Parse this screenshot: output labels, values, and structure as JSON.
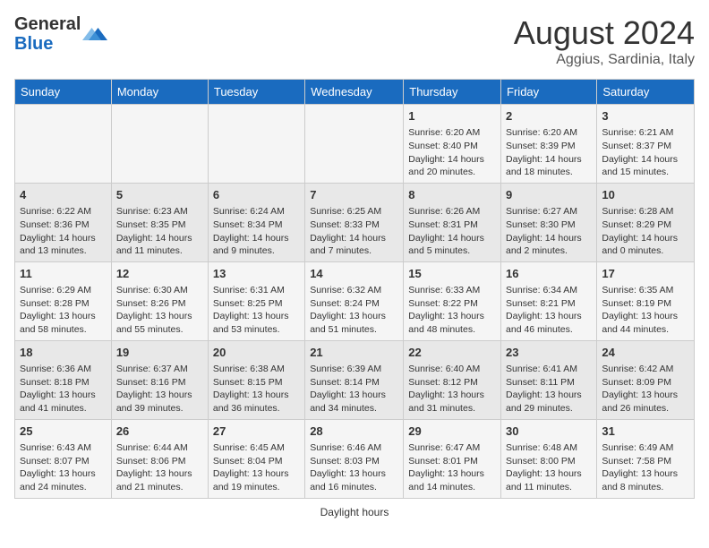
{
  "header": {
    "logo_general": "General",
    "logo_blue": "Blue",
    "month_year": "August 2024",
    "location": "Aggius, Sardinia, Italy"
  },
  "days_of_week": [
    "Sunday",
    "Monday",
    "Tuesday",
    "Wednesday",
    "Thursday",
    "Friday",
    "Saturday"
  ],
  "weeks": [
    [
      {
        "day": "",
        "content": ""
      },
      {
        "day": "",
        "content": ""
      },
      {
        "day": "",
        "content": ""
      },
      {
        "day": "",
        "content": ""
      },
      {
        "day": "1",
        "content": "Sunrise: 6:20 AM\nSunset: 8:40 PM\nDaylight: 14 hours and 20 minutes."
      },
      {
        "day": "2",
        "content": "Sunrise: 6:20 AM\nSunset: 8:39 PM\nDaylight: 14 hours and 18 minutes."
      },
      {
        "day": "3",
        "content": "Sunrise: 6:21 AM\nSunset: 8:37 PM\nDaylight: 14 hours and 15 minutes."
      }
    ],
    [
      {
        "day": "4",
        "content": "Sunrise: 6:22 AM\nSunset: 8:36 PM\nDaylight: 14 hours and 13 minutes."
      },
      {
        "day": "5",
        "content": "Sunrise: 6:23 AM\nSunset: 8:35 PM\nDaylight: 14 hours and 11 minutes."
      },
      {
        "day": "6",
        "content": "Sunrise: 6:24 AM\nSunset: 8:34 PM\nDaylight: 14 hours and 9 minutes."
      },
      {
        "day": "7",
        "content": "Sunrise: 6:25 AM\nSunset: 8:33 PM\nDaylight: 14 hours and 7 minutes."
      },
      {
        "day": "8",
        "content": "Sunrise: 6:26 AM\nSunset: 8:31 PM\nDaylight: 14 hours and 5 minutes."
      },
      {
        "day": "9",
        "content": "Sunrise: 6:27 AM\nSunset: 8:30 PM\nDaylight: 14 hours and 2 minutes."
      },
      {
        "day": "10",
        "content": "Sunrise: 6:28 AM\nSunset: 8:29 PM\nDaylight: 14 hours and 0 minutes."
      }
    ],
    [
      {
        "day": "11",
        "content": "Sunrise: 6:29 AM\nSunset: 8:28 PM\nDaylight: 13 hours and 58 minutes."
      },
      {
        "day": "12",
        "content": "Sunrise: 6:30 AM\nSunset: 8:26 PM\nDaylight: 13 hours and 55 minutes."
      },
      {
        "day": "13",
        "content": "Sunrise: 6:31 AM\nSunset: 8:25 PM\nDaylight: 13 hours and 53 minutes."
      },
      {
        "day": "14",
        "content": "Sunrise: 6:32 AM\nSunset: 8:24 PM\nDaylight: 13 hours and 51 minutes."
      },
      {
        "day": "15",
        "content": "Sunrise: 6:33 AM\nSunset: 8:22 PM\nDaylight: 13 hours and 48 minutes."
      },
      {
        "day": "16",
        "content": "Sunrise: 6:34 AM\nSunset: 8:21 PM\nDaylight: 13 hours and 46 minutes."
      },
      {
        "day": "17",
        "content": "Sunrise: 6:35 AM\nSunset: 8:19 PM\nDaylight: 13 hours and 44 minutes."
      }
    ],
    [
      {
        "day": "18",
        "content": "Sunrise: 6:36 AM\nSunset: 8:18 PM\nDaylight: 13 hours and 41 minutes."
      },
      {
        "day": "19",
        "content": "Sunrise: 6:37 AM\nSunset: 8:16 PM\nDaylight: 13 hours and 39 minutes."
      },
      {
        "day": "20",
        "content": "Sunrise: 6:38 AM\nSunset: 8:15 PM\nDaylight: 13 hours and 36 minutes."
      },
      {
        "day": "21",
        "content": "Sunrise: 6:39 AM\nSunset: 8:14 PM\nDaylight: 13 hours and 34 minutes."
      },
      {
        "day": "22",
        "content": "Sunrise: 6:40 AM\nSunset: 8:12 PM\nDaylight: 13 hours and 31 minutes."
      },
      {
        "day": "23",
        "content": "Sunrise: 6:41 AM\nSunset: 8:11 PM\nDaylight: 13 hours and 29 minutes."
      },
      {
        "day": "24",
        "content": "Sunrise: 6:42 AM\nSunset: 8:09 PM\nDaylight: 13 hours and 26 minutes."
      }
    ],
    [
      {
        "day": "25",
        "content": "Sunrise: 6:43 AM\nSunset: 8:07 PM\nDaylight: 13 hours and 24 minutes."
      },
      {
        "day": "26",
        "content": "Sunrise: 6:44 AM\nSunset: 8:06 PM\nDaylight: 13 hours and 21 minutes."
      },
      {
        "day": "27",
        "content": "Sunrise: 6:45 AM\nSunset: 8:04 PM\nDaylight: 13 hours and 19 minutes."
      },
      {
        "day": "28",
        "content": "Sunrise: 6:46 AM\nSunset: 8:03 PM\nDaylight: 13 hours and 16 minutes."
      },
      {
        "day": "29",
        "content": "Sunrise: 6:47 AM\nSunset: 8:01 PM\nDaylight: 13 hours and 14 minutes."
      },
      {
        "day": "30",
        "content": "Sunrise: 6:48 AM\nSunset: 8:00 PM\nDaylight: 13 hours and 11 minutes."
      },
      {
        "day": "31",
        "content": "Sunrise: 6:49 AM\nSunset: 7:58 PM\nDaylight: 13 hours and 8 minutes."
      }
    ]
  ],
  "footer": {
    "daylight_label": "Daylight hours"
  }
}
